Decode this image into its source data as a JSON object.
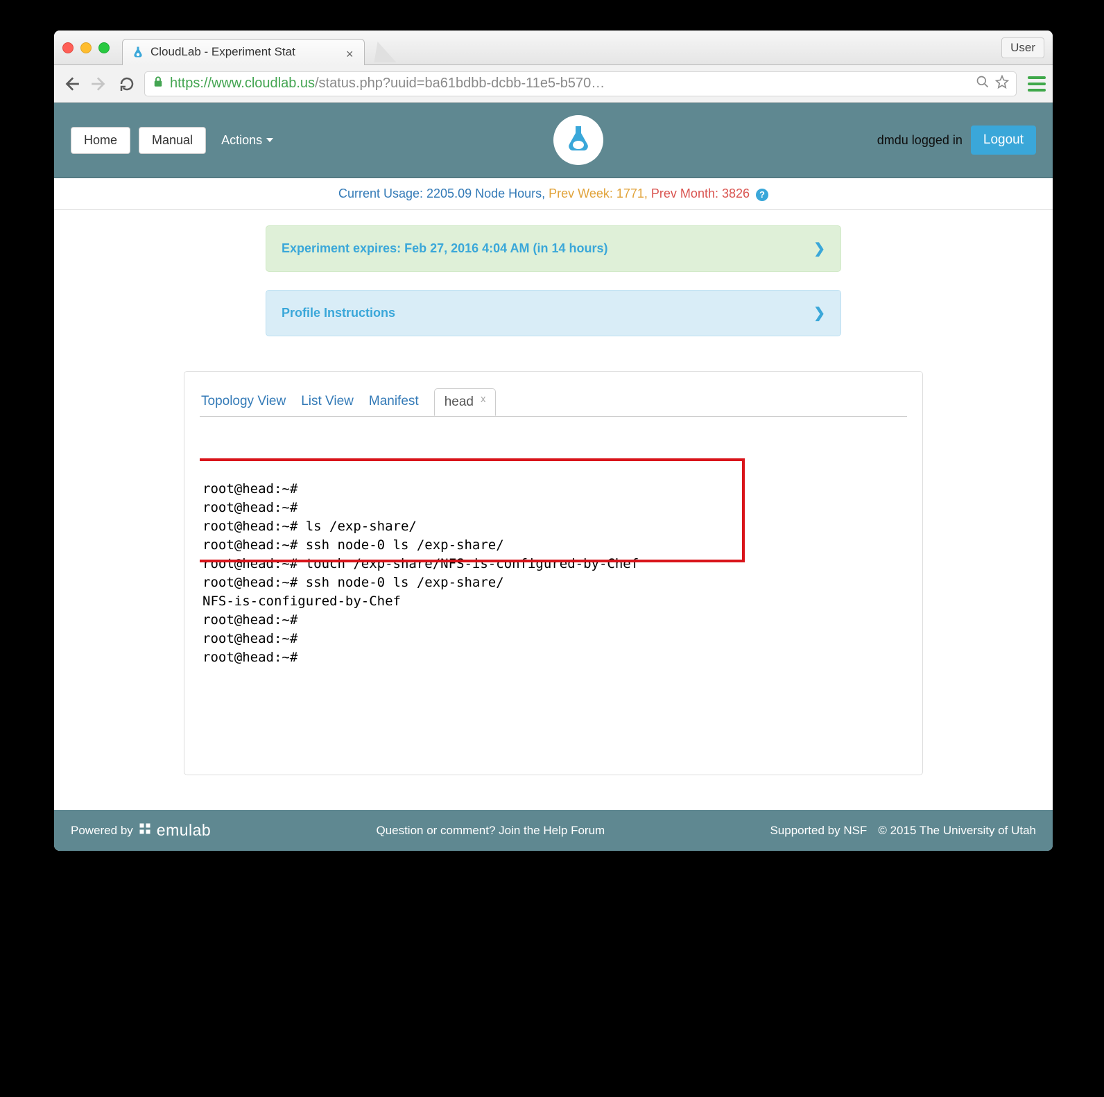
{
  "window": {
    "tab_title": "CloudLab - Experiment Stat",
    "user_button": "User"
  },
  "address": {
    "scheme": "https://",
    "host": "www.cloudlab.us",
    "path": "/status.php?uuid=ba61bdbb-dcbb-11e5-b570…"
  },
  "nav": {
    "home": "Home",
    "manual": "Manual",
    "actions": "Actions",
    "logged_in_user": "dmdu logged in",
    "logout": "Logout"
  },
  "usage": {
    "current_label": "Current Usage: 2205.09 Node Hours,",
    "prev_week": "Prev Week: 1771,",
    "prev_month": "Prev Month: 3826"
  },
  "panels": {
    "expires": "Experiment expires: Feb 27, 2016 4:04 AM (in 14 hours)",
    "instructions": "Profile Instructions"
  },
  "tabs": {
    "topology": "Topology View",
    "list": "List View",
    "manifest": "Manifest",
    "active": "head"
  },
  "terminal_lines": [
    "root@head:~#",
    "root@head:~#",
    "root@head:~# ls /exp-share/",
    "root@head:~# ssh node-0 ls /exp-share/",
    "root@head:~# touch /exp-share/NFS-is-configured-by-Chef",
    "root@head:~# ssh node-0 ls /exp-share/",
    "NFS-is-configured-by-Chef",
    "root@head:~#",
    "root@head:~#",
    "root@head:~#"
  ],
  "footer": {
    "powered_by": "Powered by",
    "emulab": "emulab",
    "question": "Question or comment? Join the Help Forum",
    "supported": "Supported by NSF",
    "copyright": "© 2015 The University of Utah"
  }
}
